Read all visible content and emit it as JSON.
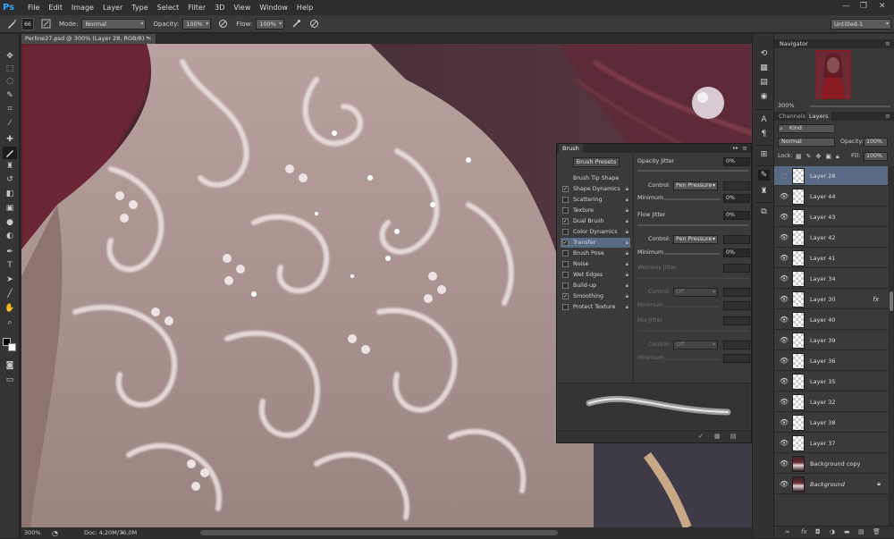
{
  "app": {
    "logo": "Ps"
  },
  "menu": [
    "File",
    "Edit",
    "Image",
    "Layer",
    "Type",
    "Select",
    "Filter",
    "3D",
    "View",
    "Window",
    "Help"
  ],
  "window_controls": {
    "minimize": "—",
    "restore": "❐",
    "close": "✕"
  },
  "options": {
    "brush_size": "66",
    "mode_label": "Mode:",
    "mode_value": "Normal",
    "opacity_label": "Opacity:",
    "opacity_value": "100%",
    "flow_label": "Flow:",
    "flow_value": "100%",
    "workspace": "Untitled-1"
  },
  "document": {
    "tab_title": "Perline27.psd @ 300% (Layer 28, RGB/8) *",
    "close": "×",
    "zoom": "300%",
    "doc_info": "Doc: 4,20M/70,0M"
  },
  "tools": [
    "move-icon",
    "marquee-icon",
    "lasso-icon",
    "quick-select-icon",
    "crop-icon",
    "eyedropper-icon",
    "healing-icon",
    "brush-icon",
    "clone-stamp-icon",
    "history-brush-icon",
    "eraser-icon",
    "gradient-icon",
    "blur-icon",
    "dodge-icon",
    "pen-icon",
    "type-icon",
    "path-select-icon",
    "shape-icon",
    "hand-icon",
    "zoom-icon"
  ],
  "navigator": {
    "title": "Navigator",
    "zoom": "300%"
  },
  "layers_panel": {
    "tab_channels": "Channels",
    "tab_layers": "Layers",
    "kind": "Kind",
    "blend": "Normal",
    "opacity_label": "Opacity:",
    "opacity_value": "100%",
    "lock_label": "Lock:",
    "fill_label": "Fill:",
    "fill_value": "100%",
    "layers": [
      {
        "name": "Layer 28",
        "selected": true
      },
      {
        "name": "Layer 44"
      },
      {
        "name": "Layer 43"
      },
      {
        "name": "Layer 42"
      },
      {
        "name": "Layer 41"
      },
      {
        "name": "Layer 34"
      },
      {
        "name": "Layer 30",
        "fx": "fx"
      },
      {
        "name": "Layer 40"
      },
      {
        "name": "Layer 39"
      },
      {
        "name": "Layer 36"
      },
      {
        "name": "Layer 35"
      },
      {
        "name": "Layer 32"
      },
      {
        "name": "Layer 38"
      },
      {
        "name": "Layer 37"
      },
      {
        "name": "Background copy",
        "image": true
      },
      {
        "name": "Background",
        "image": true,
        "italic": true,
        "locked": true
      }
    ]
  },
  "brush_panel": {
    "tab": "Brush",
    "presets_button": "Brush Presets",
    "items": [
      {
        "label": "Brush Tip Shape",
        "checkbox": false,
        "lock": false
      },
      {
        "label": "Shape Dynamics",
        "checked": true,
        "checkbox": true,
        "lock": true
      },
      {
        "label": "Scattering",
        "checked": false,
        "checkbox": true,
        "lock": true
      },
      {
        "label": "Texture",
        "checked": false,
        "checkbox": true,
        "lock": true
      },
      {
        "label": "Dual Brush",
        "checked": true,
        "checkbox": true,
        "lock": true
      },
      {
        "label": "Color Dynamics",
        "checked": false,
        "checkbox": true,
        "lock": true
      },
      {
        "label": "Transfer",
        "checked": true,
        "checkbox": true,
        "lock": true,
        "highlight": true
      },
      {
        "label": "Brush Pose",
        "checked": false,
        "checkbox": true,
        "lock": true
      },
      {
        "label": "Noise",
        "checked": false,
        "checkbox": true,
        "lock": true
      },
      {
        "label": "Wet Edges",
        "checked": false,
        "checkbox": true,
        "lock": true
      },
      {
        "label": "Build-up",
        "checked": false,
        "checkbox": true,
        "lock": true
      },
      {
        "label": "Smoothing",
        "checked": true,
        "checkbox": true,
        "lock": true
      },
      {
        "label": "Protect Texture",
        "checked": false,
        "checkbox": true,
        "lock": true
      }
    ],
    "opacity_jitter_label": "Opacity Jitter",
    "opacity_jitter_value": "0%",
    "control_label": "Control:",
    "control_value": "Pen Pressure",
    "minimum_label": "Minimum",
    "minimum_value": "0%",
    "flow_jitter_label": "Flow Jitter",
    "flow_jitter_value": "0%",
    "control2_value": "Pen Pressure",
    "minimum2_value": "0%",
    "wetness_jitter_label": "Wetness Jitter",
    "control3_value": "Off",
    "mix_jitter_label": "Mix Jitter",
    "control4_value": "Off"
  }
}
